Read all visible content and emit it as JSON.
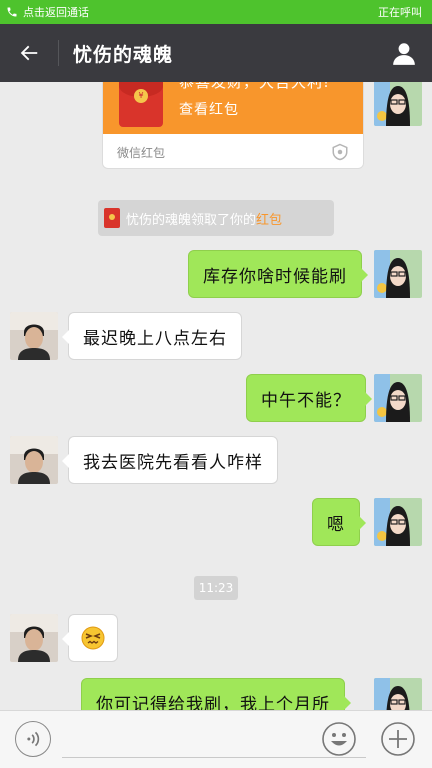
{
  "call_banner": {
    "left_text": "点击返回通话",
    "right_text": "正在呼叫"
  },
  "header": {
    "title": "忧伤的魂魄"
  },
  "red_packet": {
    "greeting": "恭喜发财，大吉大利!",
    "action": "查看红包",
    "footer": "微信红包"
  },
  "notice": {
    "prefix": "忧伤的魂魄领取了你的",
    "highlight": "红包"
  },
  "messages": [
    {
      "side": "me",
      "text": "库存你啥时候能刷"
    },
    {
      "side": "other",
      "text": "最迟晚上八点左右"
    },
    {
      "side": "me",
      "text": "中午不能？"
    },
    {
      "side": "other",
      "text": "我去医院先看看人咋样"
    },
    {
      "side": "me",
      "text": "嗯"
    },
    {
      "side": "other",
      "text": "😣"
    },
    {
      "side": "me",
      "text": "你可记得给我刷，我上个月所"
    }
  ],
  "timestamp": "11:23",
  "colors": {
    "accent_green": "#4ec32d",
    "bubble_me": "#a0e759",
    "header_bg": "#3a3a3f",
    "packet_orange": "#f8962c"
  }
}
